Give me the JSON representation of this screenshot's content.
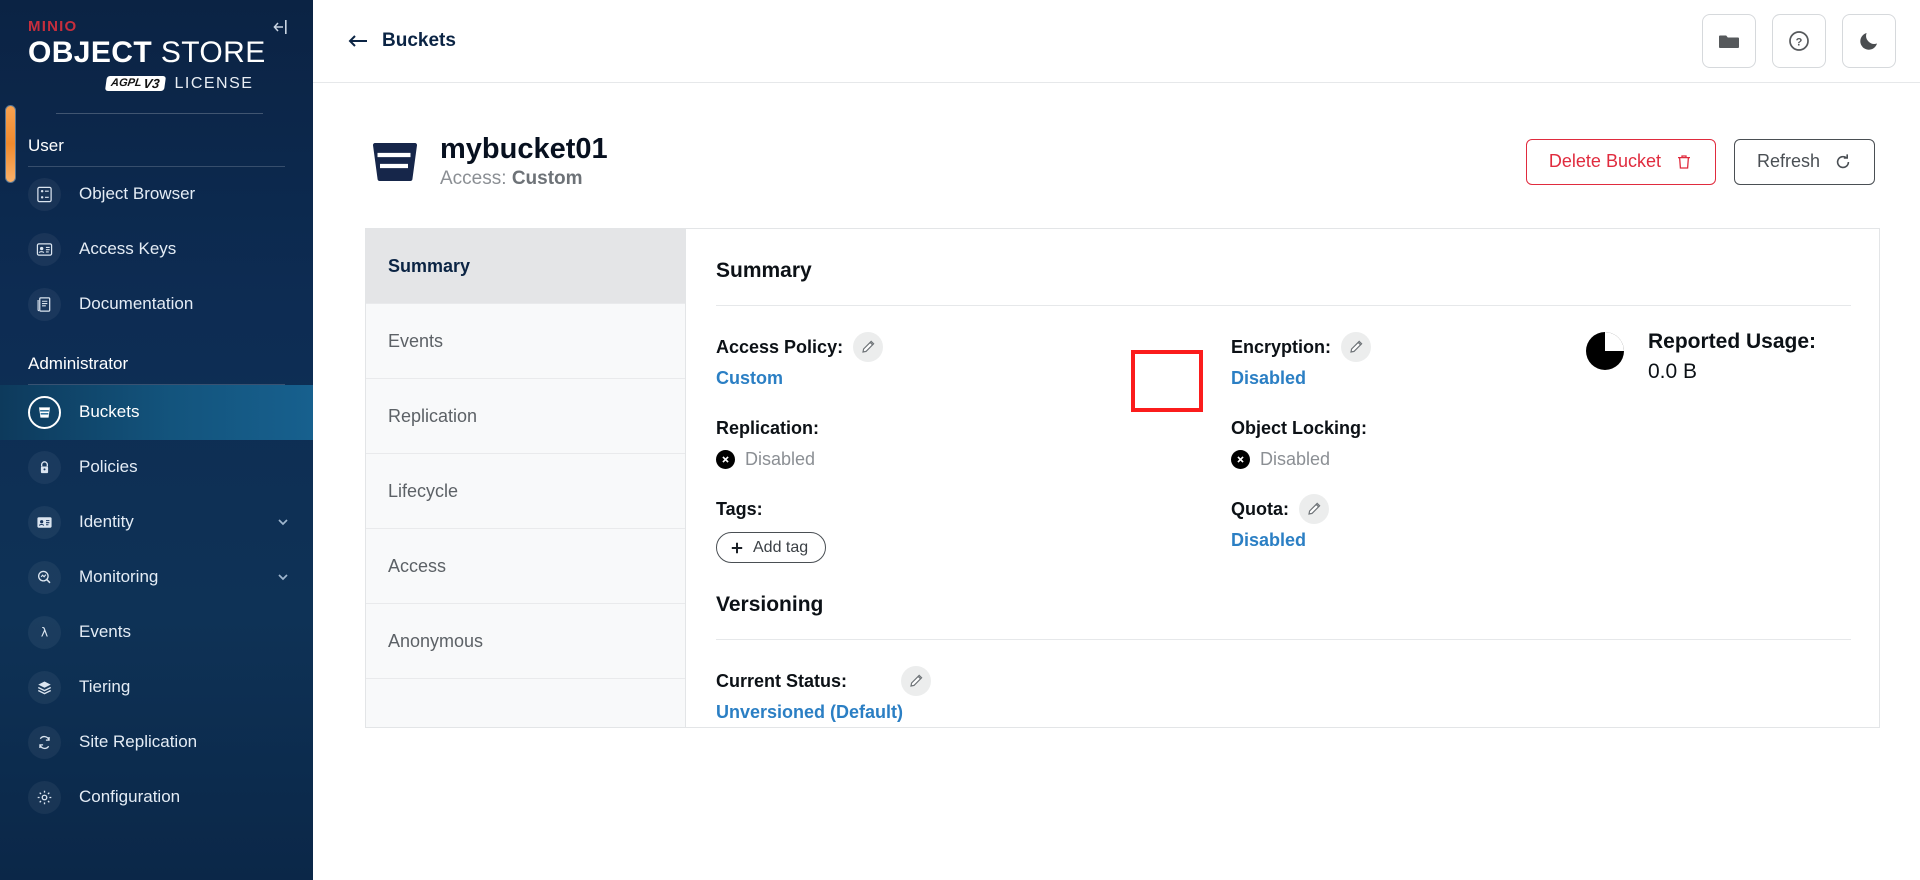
{
  "sidebar": {
    "logo": {
      "brand": "MINIO",
      "line_bold": "OBJECT",
      "line_light": "STORE",
      "agpl": "AGPL",
      "agpl_version": "V3",
      "license": "LICENSE"
    },
    "collapse_icon": "collapse-left-icon",
    "sections": [
      {
        "title": "User",
        "items": [
          {
            "label": "Object Browser",
            "icon": "object-browser-icon",
            "active": false,
            "expandable": false
          },
          {
            "label": "Access Keys",
            "icon": "access-keys-icon",
            "active": false,
            "expandable": false
          },
          {
            "label": "Documentation",
            "icon": "documentation-icon",
            "active": false,
            "expandable": false
          }
        ]
      },
      {
        "title": "Administrator",
        "items": [
          {
            "label": "Buckets",
            "icon": "bucket-icon",
            "active": true,
            "expandable": false
          },
          {
            "label": "Policies",
            "icon": "lock-icon",
            "active": false,
            "expandable": false
          },
          {
            "label": "Identity",
            "icon": "identity-card-icon",
            "active": false,
            "expandable": true
          },
          {
            "label": "Monitoring",
            "icon": "monitoring-icon",
            "active": false,
            "expandable": true
          },
          {
            "label": "Events",
            "icon": "lambda-icon",
            "active": false,
            "expandable": false
          },
          {
            "label": "Tiering",
            "icon": "layers-icon",
            "active": false,
            "expandable": false
          },
          {
            "label": "Site Replication",
            "icon": "site-replication-icon",
            "active": false,
            "expandable": false
          },
          {
            "label": "Configuration",
            "icon": "gear-icon",
            "active": false,
            "expandable": false
          }
        ]
      }
    ]
  },
  "topbar": {
    "back_icon": "arrow-left-icon",
    "breadcrumb": "Buckets",
    "actions": [
      {
        "name": "folder-icon",
        "label": "folder"
      },
      {
        "name": "help-icon",
        "label": "help"
      },
      {
        "name": "dark-mode-icon",
        "label": "dark mode"
      }
    ]
  },
  "bucket": {
    "name": "mybucket01",
    "access_prefix": "Access: ",
    "access_value": "Custom",
    "delete_label": "Delete Bucket",
    "refresh_label": "Refresh"
  },
  "tabs": [
    {
      "label": "Summary",
      "active": true
    },
    {
      "label": "Events",
      "active": false
    },
    {
      "label": "Replication",
      "active": false
    },
    {
      "label": "Lifecycle",
      "active": false
    },
    {
      "label": "Access",
      "active": false
    },
    {
      "label": "Anonymous",
      "active": false
    }
  ],
  "summary": {
    "heading": "Summary",
    "access_policy": {
      "label": "Access Policy:",
      "value": "Custom",
      "editable": true,
      "style": "link"
    },
    "replication": {
      "label": "Replication:",
      "value": "Disabled",
      "editable": false,
      "style": "disabled"
    },
    "tags": {
      "label": "Tags:",
      "add_label": "Add tag"
    },
    "encryption": {
      "label": "Encryption:",
      "value": "Disabled",
      "editable": true,
      "style": "link"
    },
    "object_locking": {
      "label": "Object Locking:",
      "value": "Disabled",
      "editable": false,
      "style": "disabled"
    },
    "quota": {
      "label": "Quota:",
      "value": "Disabled",
      "editable": true,
      "style": "link"
    },
    "reported_usage": {
      "label": "Reported Usage:",
      "value": "0.0 B",
      "icon": "pie-chart-icon"
    }
  },
  "versioning": {
    "heading": "Versioning",
    "status_label": "Current Status:",
    "status_value": "Unversioned (Default)",
    "editable": true
  },
  "annotation": {
    "target": "access-policy-edit-button",
    "color": "#fb1c1c"
  },
  "colors": {
    "sidebar_bg": "#0d2c53",
    "accent_red": "#c72e3d",
    "link_blue": "#2b7fc4",
    "delete_red": "#e02b3e",
    "scrollbar_orange": "#f08a2e"
  }
}
